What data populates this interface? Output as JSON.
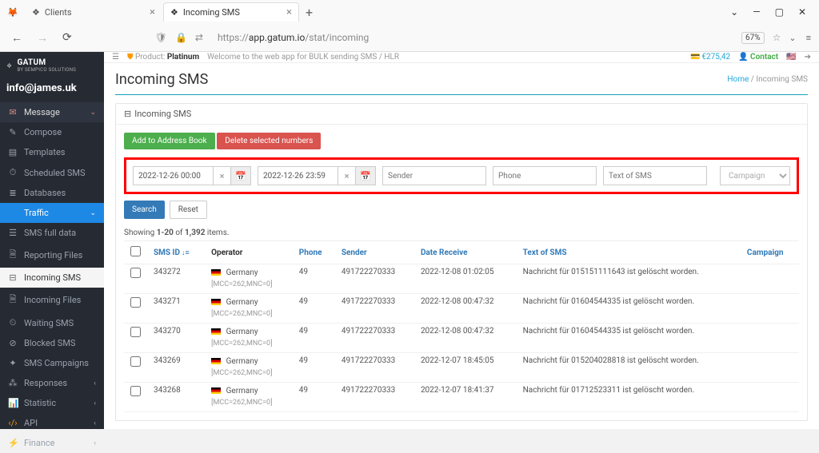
{
  "browser": {
    "tabs": [
      {
        "title": "Clients",
        "active": false
      },
      {
        "title": "Incoming SMS",
        "active": true
      }
    ],
    "url_prefix": "https://",
    "url_host": "app.gatum.io",
    "url_path": "/stat/incoming",
    "zoom": "67%"
  },
  "brand": {
    "name": "GATUM",
    "sub": "BY SEMPICO SOLUTIONS"
  },
  "user": "info@james.uk",
  "sidebar": {
    "message": "Message",
    "items_top": [
      "Compose",
      "Templates",
      "Scheduled SMS",
      "Databases"
    ],
    "traffic": "Traffic",
    "items_traffic": [
      "SMS full data",
      "Reporting Files",
      "Incoming SMS",
      "Incoming Files",
      "Waiting SMS",
      "Blocked SMS",
      "SMS Campaigns"
    ],
    "items_bottom": [
      "Responses",
      "Statistic",
      "API",
      "Finance"
    ]
  },
  "topbar": {
    "product_label": "Product:",
    "product": "Platinum",
    "welcome": "Welcome to the web app for BULK sending SMS / HLR",
    "balance": "€275,42",
    "contact": "Contact"
  },
  "page": {
    "title": "Incoming SMS",
    "home": "Home",
    "crumb": "Incoming SMS",
    "panel_title": "Incoming SMS",
    "btn_add": "Add to Address Book",
    "btn_del": "Delete selected numbers",
    "date_from": "2022-12-26 00:00",
    "date_to": "2022-12-26 23:59",
    "ph_sender": "Sender",
    "ph_phone": "Phone",
    "ph_text": "Text of SMS",
    "ph_campaign": "Campaign",
    "btn_search": "Search",
    "btn_reset": "Reset",
    "summary_pre": "Showing ",
    "summary_range": "1-20",
    "summary_of": " of ",
    "summary_total": "1,392",
    "summary_post": " items."
  },
  "columns": {
    "smsid": "SMS ID",
    "operator": "Operator",
    "phone": "Phone",
    "sender": "Sender",
    "date": "Date Receive",
    "text": "Text of SMS",
    "campaign": "Campaign"
  },
  "rows": [
    {
      "id": "343272",
      "country": "Germany",
      "mcc": "[MCC=262,MNC=0]",
      "phone": "49",
      "sender": "491722270333",
      "date": "2022-12-08 01:02:05",
      "text": "Nachricht für 015151111643 ist gelöscht worden."
    },
    {
      "id": "343271",
      "country": "Germany",
      "mcc": "[MCC=262,MNC=0]",
      "phone": "49",
      "sender": "491722270333",
      "date": "2022-12-08 00:47:32",
      "text": "Nachricht für 01604544335 ist gelöscht worden."
    },
    {
      "id": "343270",
      "country": "Germany",
      "mcc": "[MCC=262,MNC=0]",
      "phone": "49",
      "sender": "491722270333",
      "date": "2022-12-08 00:47:32",
      "text": "Nachricht für 01604544335 ist gelöscht worden."
    },
    {
      "id": "343269",
      "country": "Germany",
      "mcc": "[MCC=262,MNC=0]",
      "phone": "49",
      "sender": "491722270333",
      "date": "2022-12-07 18:45:05",
      "text": "Nachricht für 015204028818 ist gelöscht worden."
    },
    {
      "id": "343268",
      "country": "Germany",
      "mcc": "[MCC=262,MNC=0]",
      "phone": "49",
      "sender": "491722270333",
      "date": "2022-12-07 18:41:37",
      "text": "Nachricht für 01712523311 ist gelöscht worden."
    }
  ]
}
